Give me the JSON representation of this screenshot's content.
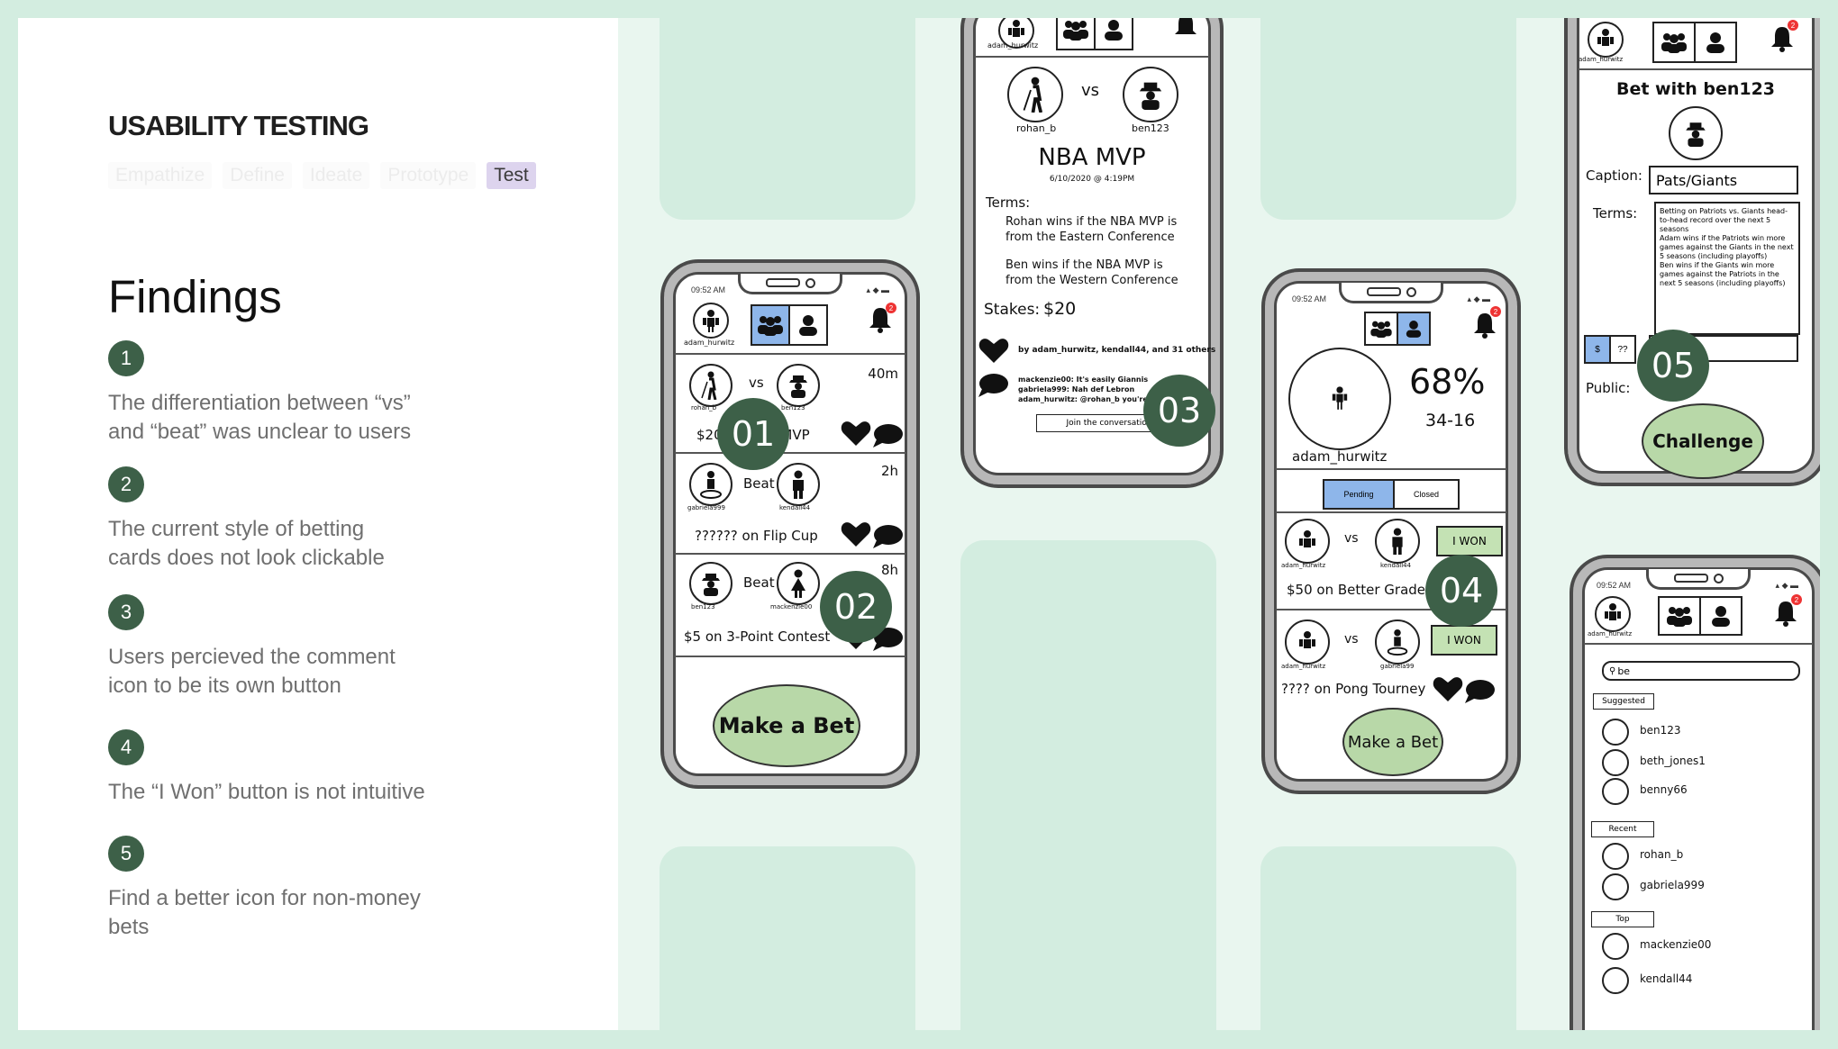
{
  "header": {
    "title": "USABILITY TESTING"
  },
  "phases": [
    "Empathize",
    "Define",
    "Ideate",
    "Prototype",
    "Test"
  ],
  "active_phase": "Test",
  "findings_title": "Findings",
  "findings": [
    {
      "num": "1",
      "text": "The differentiation between “vs” and “beat” was unclear to users"
    },
    {
      "num": "2",
      "text": "The current style of betting cards does not look clickable"
    },
    {
      "num": "3",
      "text": "Users percieved the comment icon to be its own button"
    },
    {
      "num": "4",
      "text": "The “I Won” button is not intuitive"
    },
    {
      "num": "5",
      "text": "Find a better icon for non-money bets"
    }
  ],
  "markers": [
    "01",
    "02",
    "03",
    "04",
    "05"
  ],
  "phone1": {
    "time": "09:52 AM",
    "user": "adam_hurwitz",
    "badge": "2",
    "bets": [
      {
        "left": "rohan_b",
        "connector": "vs",
        "right": "ben123",
        "age": "40m",
        "desc": "$20 on NBA MVP"
      },
      {
        "left": "gabriela999",
        "connector": "Beat",
        "right": "kendall44",
        "age": "2h",
        "desc": "?????? on Flip Cup"
      },
      {
        "left": "ben123",
        "connector": "Beat",
        "right": "mackenzie00",
        "age": "8h",
        "desc": "$5 on 3-Point Contest"
      }
    ],
    "cta": "Make a Bet"
  },
  "phone2": {
    "user": "adam_hurwitz",
    "left": "rohan_b",
    "connector": "vs",
    "right": "ben123",
    "title": "NBA MVP",
    "date": "6/10/2020 @ 4:19PM",
    "terms_label": "Terms:",
    "terms": [
      "Rohan wins if the NBA MVP is from the Eastern Conference",
      "Ben wins if the NBA MVP is from the Western Conference"
    ],
    "stakes_label": "Stakes:",
    "stakes_value": "$20",
    "likes": "by adam_hurwitz, kendall44, and 31 others",
    "comments": [
      "mackenzie00: It's easily Giannis",
      "gabriela999: Nah def Lebron",
      "adam_hurwitz: @rohan_b you're..."
    ],
    "join": "Join the conversation"
  },
  "phone3": {
    "time": "09:52 AM",
    "badge": "2",
    "percent": "68%",
    "record": "34-16",
    "user": "adam_hurwitz",
    "tabs": [
      "Pending",
      "Closed"
    ],
    "bets": [
      {
        "left": "adam_hurwitz",
        "connector": "vs",
        "right": "kendall44",
        "desc": "$50 on Better Grade",
        "action": "I WON"
      },
      {
        "left": "adam_hurwitz",
        "connector": "vs",
        "right": "gabriela99",
        "desc": "???? on Pong Tourney",
        "action": "I WON"
      }
    ],
    "cta": "Make a Bet"
  },
  "phone4": {
    "user": "adam_hurwitz",
    "badge": "2",
    "title": "Bet with ben123",
    "caption_label": "Caption:",
    "caption_value": "Pats/Giants",
    "terms_label": "Terms:",
    "terms": [
      "Betting on Patriots vs. Giants head-to-head record over the next 5 seasons",
      "Adam wins if the Patriots win more games against the Giants in the next 5 seasons (including playoffs)",
      "Ben wins if the Giants win more games against the Patriots in the next 5 seasons (including playoffs)"
    ],
    "stake_options": [
      "$",
      "??"
    ],
    "public_label": "Public:",
    "cta": "Challenge"
  },
  "phone5": {
    "time": "09:52 AM",
    "user": "adam_hurwitz",
    "badge": "2",
    "search_value": "be",
    "sections": [
      {
        "label": "Suggested",
        "users": [
          "ben123",
          "beth_jones1",
          "benny66"
        ]
      },
      {
        "label": "Recent",
        "users": [
          "rohan_b",
          "gabriela999"
        ]
      },
      {
        "label": "Top",
        "users": [
          "mackenzie00",
          "kendall44"
        ]
      }
    ]
  }
}
